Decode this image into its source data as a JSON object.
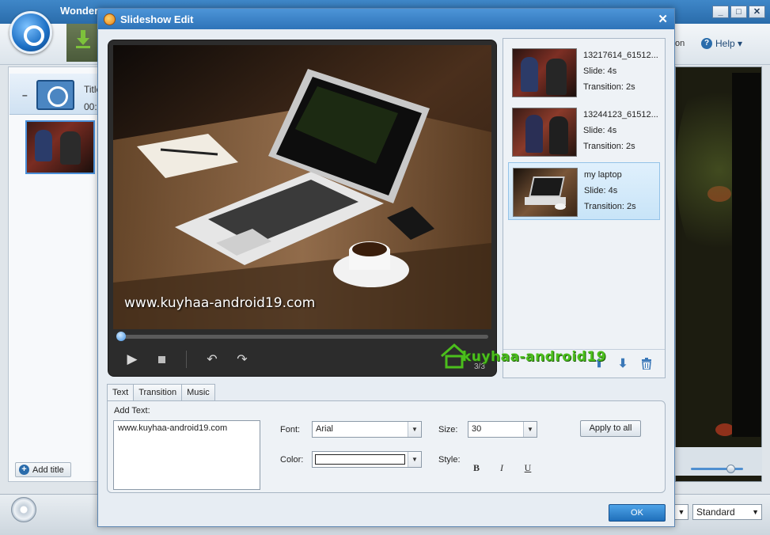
{
  "app": {
    "title": "Wonder",
    "toolbar_partial_label": "on",
    "help_label": "Help ▾",
    "list": {
      "collapse_glyph": "–",
      "title_col": "Title",
      "duration_col": "00:"
    },
    "add_title_label": "Add title",
    "quality_select": "Standard",
    "window_buttons": [
      "_",
      "□",
      "✕"
    ]
  },
  "dialog": {
    "title": "Slideshow Edit",
    "close_glyph": "✕",
    "player": {
      "caption": "www.kuyhaa-android19.com",
      "counter": "3/3",
      "progress": 0.0
    },
    "slides": [
      {
        "name": "13217614_61512...",
        "slide": "Slide: 4s",
        "transition": "Transition: 2s",
        "selected": false
      },
      {
        "name": "13244123_61512...",
        "slide": "Slide: 4s",
        "transition": "Transition: 2s",
        "selected": false
      },
      {
        "name": "my laptop",
        "slide": "Slide: 4s",
        "transition": "Transition: 2s",
        "selected": true
      }
    ],
    "watermark": "kuyhaa-android19",
    "tabs": [
      "Text",
      "Transition",
      "Music"
    ],
    "active_tab": "Text",
    "text_panel": {
      "add_text_label": "Add Text:",
      "text_value": "www.kuyhaa-android19.com",
      "font_label": "Font:",
      "font_value": "Arial",
      "size_label": "Size:",
      "size_value": "30",
      "color_label": "Color:",
      "color_value": "#ffffff",
      "style_label": "Style:",
      "style_bold": "B",
      "style_italic": "I",
      "style_underline": "U",
      "apply_label": "Apply to all"
    },
    "ok_label": "OK"
  }
}
